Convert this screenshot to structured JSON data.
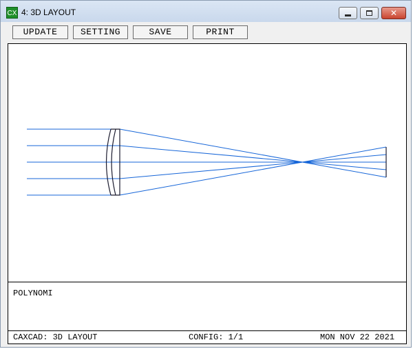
{
  "window": {
    "icon_label": "CX",
    "title": "4: 3D LAYOUT",
    "close_glyph": "✕"
  },
  "toolbar": {
    "update_label": "UPDATE",
    "setting_label": "SETTING",
    "save_label": "SAVE",
    "print_label": "PRINT"
  },
  "message": {
    "text": "POLYNOMI"
  },
  "status": {
    "left": "CAXCAD: 3D LAYOUT",
    "center": "CONFIG: 1/1",
    "right": "MON NOV 22 2021"
  },
  "colors": {
    "ray": "#1565d8",
    "lens": "#1a1a2e",
    "accent_icon": "#1f8f2a",
    "close_button": "#c9442f"
  }
}
